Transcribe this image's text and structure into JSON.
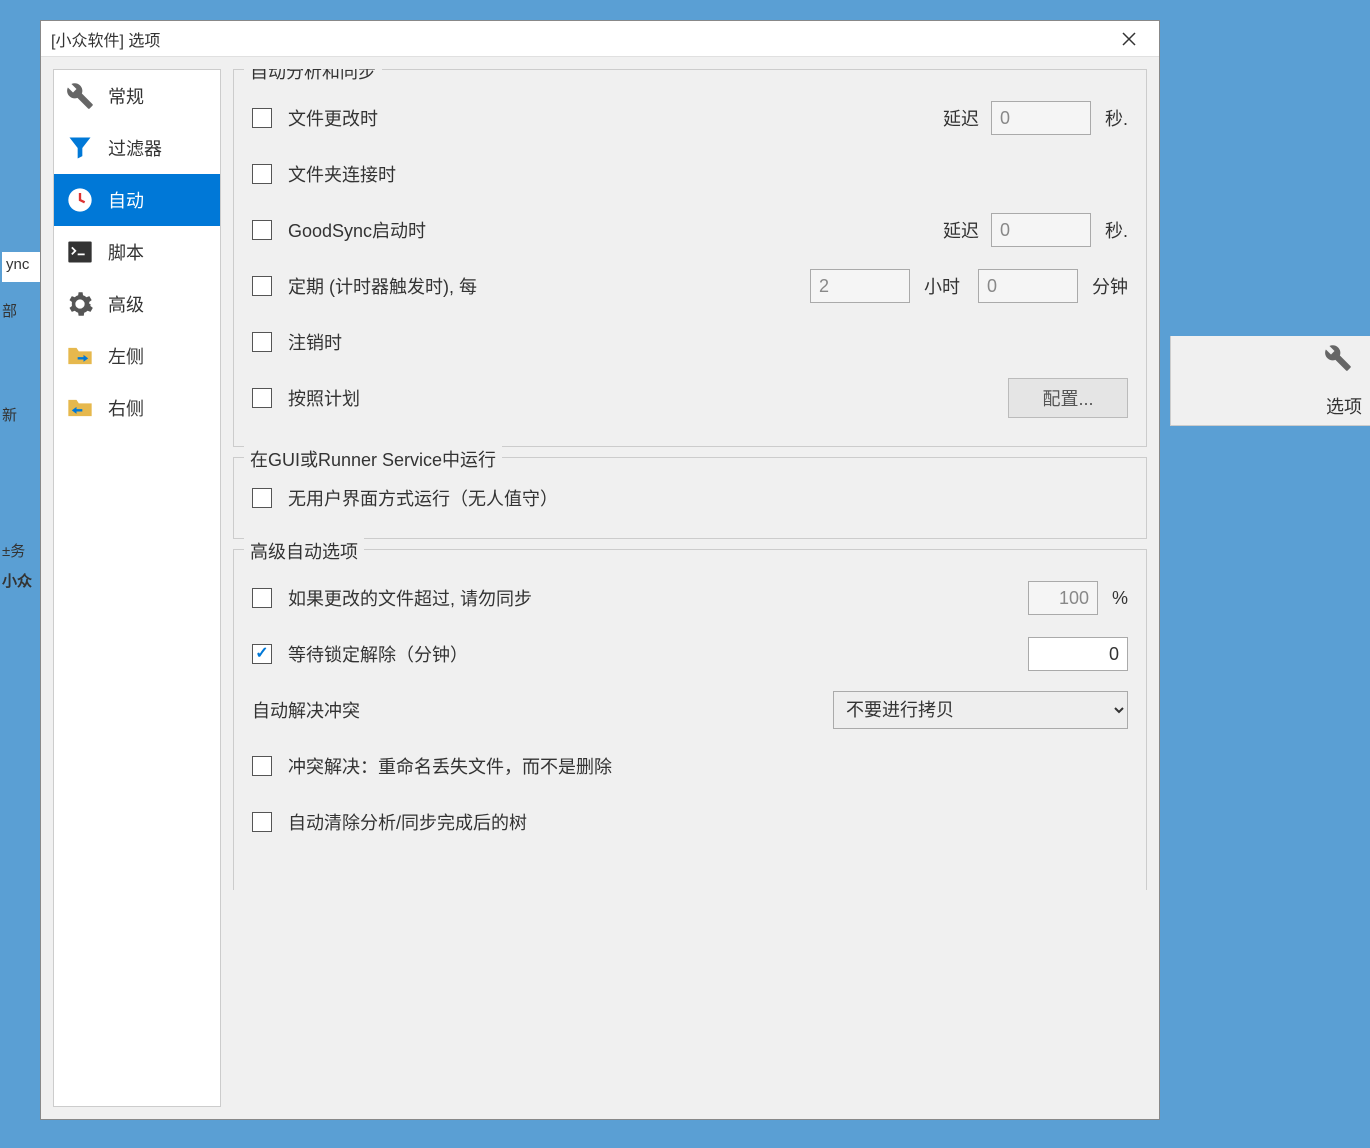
{
  "bg": {
    "ync": "ync",
    "bu": "部",
    "xin": "新",
    "renwu": "±务",
    "xiaozh": "小众",
    "xuanxiang": "选项"
  },
  "dialog": {
    "title": "[小众软件] 选项"
  },
  "sidebar": {
    "items": [
      {
        "label": "常规"
      },
      {
        "label": "过滤器"
      },
      {
        "label": "自动"
      },
      {
        "label": "脚本"
      },
      {
        "label": "高级"
      },
      {
        "label": "左侧"
      },
      {
        "label": "右侧"
      }
    ]
  },
  "group1": {
    "title": "自动分析和同步",
    "row1": {
      "label": "文件更改时",
      "delayLabel": "延迟",
      "delayValue": "0",
      "unit": "秒."
    },
    "row2": {
      "label": "文件夹连接时"
    },
    "row3": {
      "label": "GoodSync启动时",
      "delayLabel": "延迟",
      "delayValue": "0",
      "unit": "秒."
    },
    "row4": {
      "label": "定期 (计时器触发时), 每",
      "hourValue": "2",
      "hourUnit": "小时",
      "minValue": "0",
      "minUnit": "分钟"
    },
    "row5": {
      "label": "注销时"
    },
    "row6": {
      "label": "按照计划",
      "button": "配置..."
    }
  },
  "group2": {
    "title": "在GUI或Runner Service中运行",
    "row1": {
      "label": "无用户界面方式运行（无人值守）"
    }
  },
  "group3": {
    "title": "高级自动选项",
    "row1": {
      "label": "如果更改的文件超过, 请勿同步",
      "value": "100",
      "unit": "%"
    },
    "row2": {
      "label": "等待锁定解除（分钟）",
      "value": "0"
    },
    "row3": {
      "label": "自动解决冲突",
      "select": "不要进行拷贝"
    },
    "row4": {
      "label": "冲突解决：重命名丢失文件，而不是删除"
    },
    "row5": {
      "label": "自动清除分析/同步完成后的树"
    }
  }
}
